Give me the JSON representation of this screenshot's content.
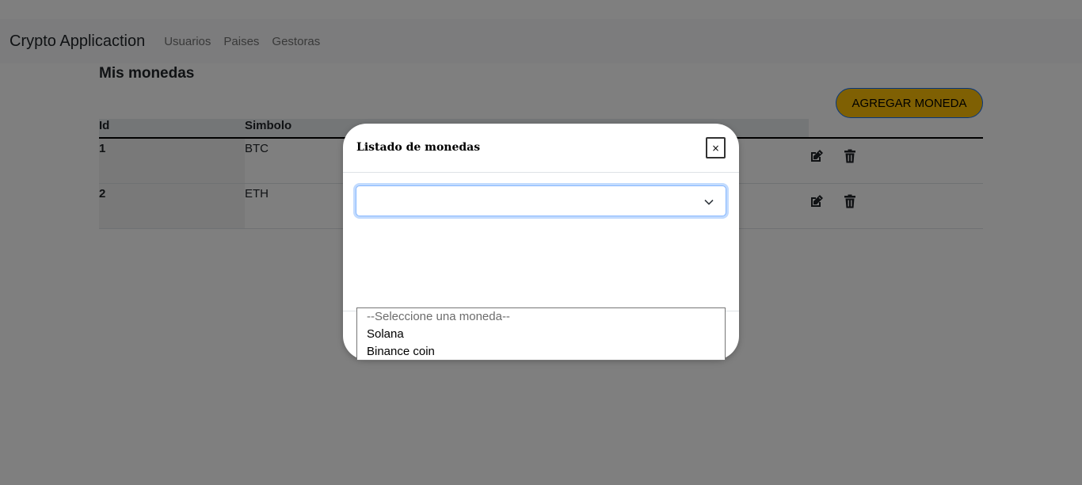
{
  "navbar": {
    "brand": "Crypto Applicaction",
    "links": [
      "Usuarios",
      "Paises",
      "Gestoras"
    ]
  },
  "main": {
    "title": "Mis monedas",
    "add_button": "AGREGAR MONEDA",
    "table": {
      "headers": [
        "Id",
        "Simbolo"
      ],
      "rows": [
        {
          "id": "1",
          "simbolo": "BTC"
        },
        {
          "id": "2",
          "simbolo": "ETH"
        }
      ],
      "row_actions": [
        "edit-icon",
        "trash-icon"
      ]
    }
  },
  "modal": {
    "title": "Listado de monedas",
    "close_label": "×",
    "select": {
      "value": "",
      "options": [
        "--Seleccione una moneda--",
        "Solana",
        "Binance coin"
      ]
    }
  },
  "colors": {
    "accent_button": "#ffc107",
    "focus_border": "#86b7fe",
    "backdrop": "rgba(0,0,0,0.5)"
  }
}
